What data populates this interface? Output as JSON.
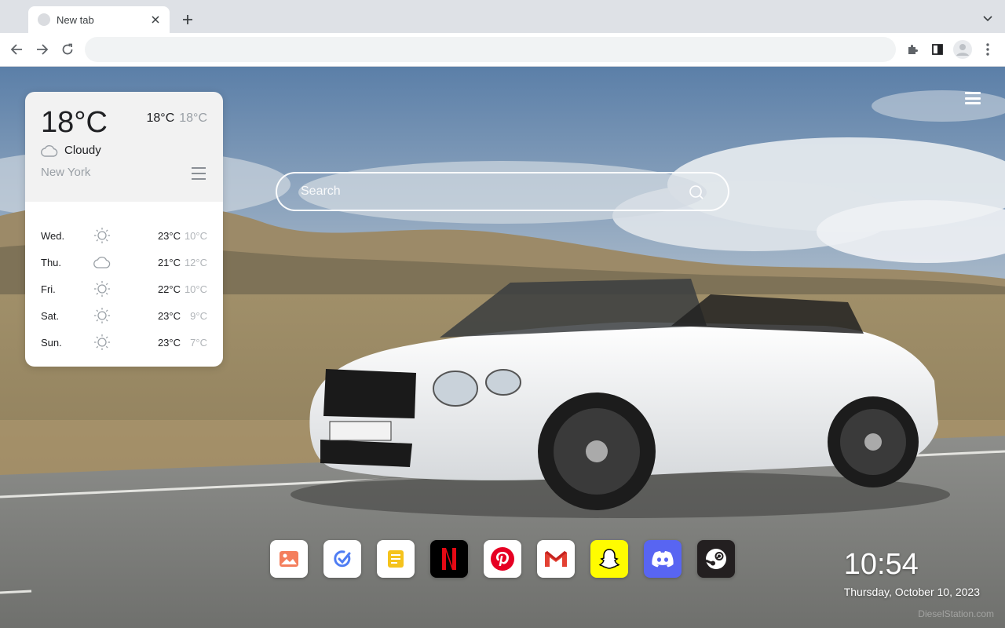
{
  "browser": {
    "tab_title": "New tab",
    "address_value": "",
    "icons": [
      "tab-close-icon",
      "plus-icon",
      "chevron-down-icon",
      "back-arrow-icon",
      "forward-arrow-icon",
      "reload-icon",
      "extensions-puzzle-icon",
      "side-panel-icon",
      "profile-avatar-icon",
      "kebab-menu-icon"
    ]
  },
  "weather": {
    "current_temp": "18°C",
    "high": "18°C",
    "low": "18°C",
    "condition": "Cloudy",
    "condition_icon": "cloud-icon",
    "city": "New York",
    "forecast": [
      {
        "day": "Wed.",
        "icon": "sun-icon",
        "high": "23°C",
        "low": "10°C"
      },
      {
        "day": "Thu.",
        "icon": "cloud-icon",
        "high": "21°C",
        "low": "12°C"
      },
      {
        "day": "Fri.",
        "icon": "sun-icon",
        "high": "22°C",
        "low": "10°C"
      },
      {
        "day": "Sat.",
        "icon": "sun-icon",
        "high": "23°C",
        "low": "9°C"
      },
      {
        "day": "Sun.",
        "icon": "sun-icon",
        "high": "23°C",
        "low": "7°C"
      }
    ]
  },
  "search": {
    "placeholder": "Search"
  },
  "dock": {
    "apps": [
      {
        "name": "gallery-app",
        "icon": "image-icon",
        "bg": "#ffffff"
      },
      {
        "name": "todo-app",
        "icon": "check-icon",
        "bg": "#ffffff"
      },
      {
        "name": "notes-app",
        "icon": "note-icon",
        "bg": "#ffffff"
      },
      {
        "name": "netflix-app",
        "icon": "netflix-icon",
        "bg": "#000000"
      },
      {
        "name": "pinterest-app",
        "icon": "pinterest-icon",
        "bg": "#ffffff"
      },
      {
        "name": "gmail-app",
        "icon": "gmail-icon",
        "bg": "#ffffff"
      },
      {
        "name": "snapchat-app",
        "icon": "snapchat-icon",
        "bg": "#fffc00"
      },
      {
        "name": "discord-app",
        "icon": "discord-icon",
        "bg": "#5865f2"
      },
      {
        "name": "steam-app",
        "icon": "steam-icon",
        "bg": "#231f20"
      }
    ]
  },
  "clock": {
    "time": "10:54",
    "date": "Thursday, October 10, 2023"
  },
  "watermark": "DieselStation.com",
  "colors": {
    "accent": "#5865f2",
    "netflix": "#e50914",
    "pinterest": "#e60023",
    "snapchat": "#fffc00"
  }
}
